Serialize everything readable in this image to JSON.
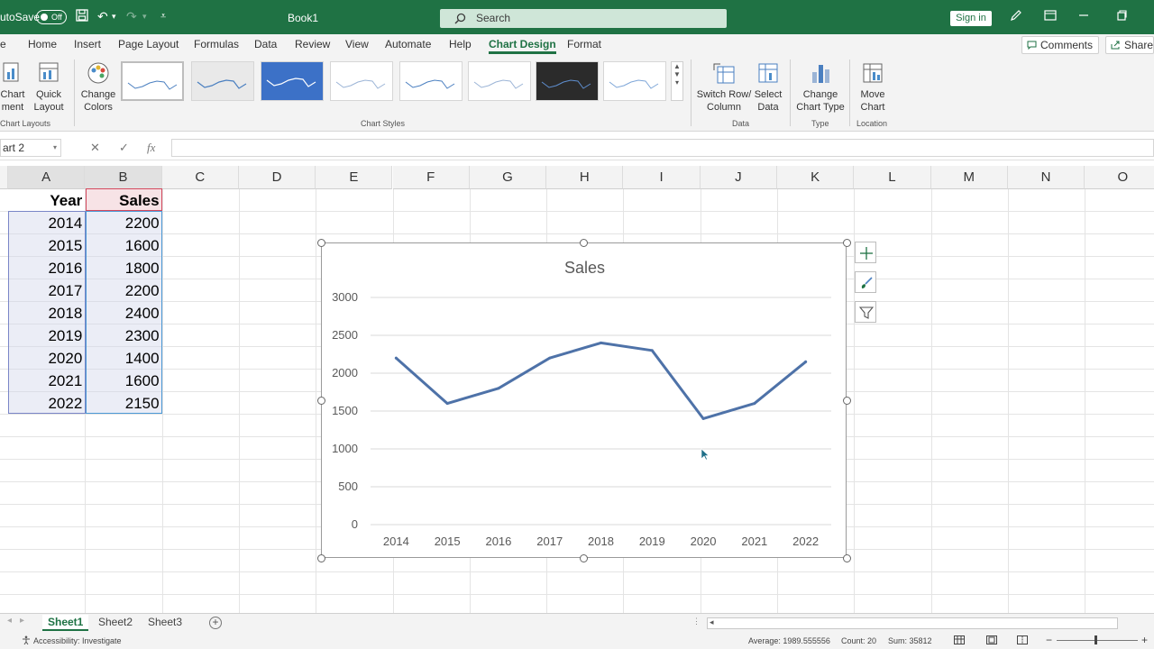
{
  "titlebar": {
    "autosave_label": "utoSave",
    "autosave_state": "Off",
    "doc_title": "Book1",
    "search_placeholder": "Search",
    "signin_label": "Sign in"
  },
  "ribbon_tabs": [
    "e",
    "Home",
    "Insert",
    "Page Layout",
    "Formulas",
    "Data",
    "Review",
    "View",
    "Automate",
    "Help",
    "Chart Design",
    "Format"
  ],
  "active_tab": "Chart Design",
  "top_buttons": {
    "comments": "Comments",
    "share": "Share"
  },
  "ribbon": {
    "add_chart_element": "Chart\nment",
    "quick_layout": "Quick\nLayout",
    "change_colors": "Change\nColors",
    "chart_layouts_group": "Chart Layouts",
    "chart_styles_group": "Chart Styles",
    "switch_row_column": "Switch Row/\nColumn",
    "select_data": "Select\nData",
    "data_group": "Data",
    "change_chart_type": "Change\nChart Type",
    "type_group": "Type",
    "move_chart": "Move\nChart",
    "location_group": "Location"
  },
  "formula_bar": {
    "name_box": "art 2",
    "fx": "fx"
  },
  "columns": [
    "A",
    "B",
    "C",
    "D",
    "E",
    "F",
    "G",
    "H",
    "I",
    "J",
    "K",
    "L",
    "M",
    "N",
    "O"
  ],
  "table": {
    "headers": [
      "Year",
      "Sales"
    ],
    "rows": [
      [
        "2014",
        "2200"
      ],
      [
        "2015",
        "1600"
      ],
      [
        "2016",
        "1800"
      ],
      [
        "2017",
        "2200"
      ],
      [
        "2018",
        "2400"
      ],
      [
        "2019",
        "2300"
      ],
      [
        "2020",
        "1400"
      ],
      [
        "2021",
        "1600"
      ],
      [
        "2022",
        "2150"
      ]
    ]
  },
  "chart_data": {
    "type": "line",
    "title": "Sales",
    "categories": [
      "2014",
      "2015",
      "2016",
      "2017",
      "2018",
      "2019",
      "2020",
      "2021",
      "2022"
    ],
    "series": [
      {
        "values": [
          2200,
          1600,
          1800,
          2200,
          2400,
          2300,
          1400,
          1600,
          2150
        ],
        "color": "#4e72a8"
      }
    ],
    "ylim": [
      0,
      3000
    ],
    "yticks": [
      "0",
      "500",
      "1000",
      "1500",
      "2000",
      "2500",
      "3000"
    ],
    "grid": true,
    "legend": "none"
  },
  "sheets": [
    "Sheet1",
    "Sheet2",
    "Sheet3"
  ],
  "active_sheet": "Sheet1",
  "status": {
    "accessibility": "Accessibility: Investigate",
    "average": "Average: 1989.555556",
    "count": "Count: 20",
    "sum": "Sum: 35812"
  },
  "colors": {
    "brand": "#1f7244",
    "series": "#4e72a8"
  }
}
